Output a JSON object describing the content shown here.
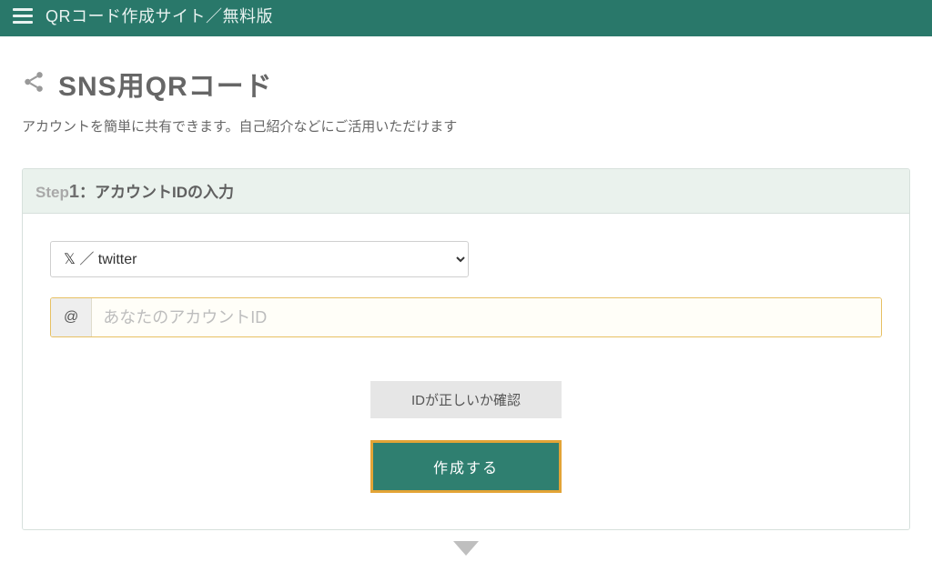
{
  "header": {
    "title": "QRコード作成サイト／無料版"
  },
  "page": {
    "title": "SNS用QRコード",
    "subtitle": "アカウントを簡単に共有できます。自己紹介などにご活用いただけます"
  },
  "panel": {
    "step_label": "Step",
    "step_num": "1",
    "step_separator": "：",
    "step_title": "アカウントIDの入力"
  },
  "form": {
    "select": {
      "selected": "𝕏 ／ twitter",
      "options": [
        "𝕏 ／ twitter"
      ]
    },
    "input": {
      "prefix": "@",
      "placeholder": "あなたのアカウントID",
      "value": ""
    },
    "buttons": {
      "check": "IDが正しいか確認",
      "create": "作成する"
    }
  }
}
